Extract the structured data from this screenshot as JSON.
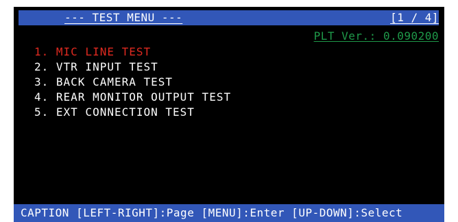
{
  "header": {
    "title": "--- TEST MENU ---",
    "page_indicator": "[1 / 4]"
  },
  "version": "PLT Ver.: 0.090200",
  "menu": {
    "items": [
      {
        "label": "1. MIC LINE TEST",
        "selected": true
      },
      {
        "label": "2. VTR INPUT TEST",
        "selected": false
      },
      {
        "label": "3. BACK CAMERA TEST",
        "selected": false
      },
      {
        "label": "4. REAR MONITOR OUTPUT TEST",
        "selected": false
      },
      {
        "label": "5. EXT CONNECTION TEST",
        "selected": false
      }
    ]
  },
  "footer": {
    "caption": "CAPTION [LEFT-RIGHT]:Page [MENU]:Enter [UP-DOWN]:Select"
  },
  "colors": {
    "bar_blue": "#3257b8",
    "selected_red": "#e02a20",
    "version_green": "#1f9a4a",
    "background": "#000000"
  }
}
